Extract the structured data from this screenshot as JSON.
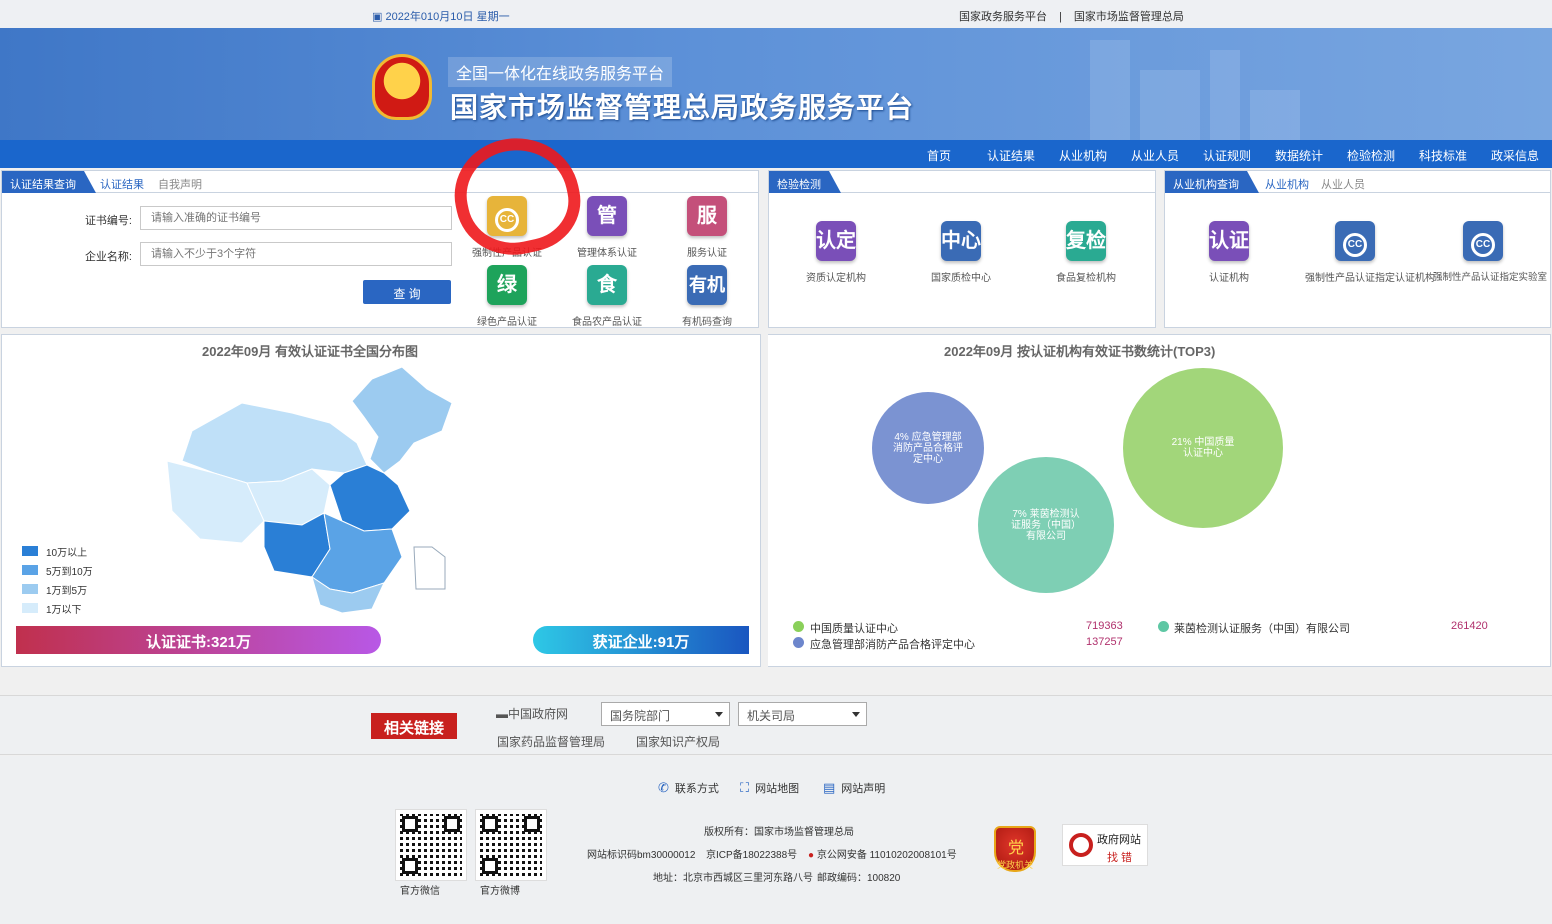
{
  "topbar": {
    "date": "2022年010月10日 星期一",
    "link1": "国家政务服务平台",
    "separator": "|",
    "link2": "国家市场监督管理总局"
  },
  "banner": {
    "subtitle": "全国一体化在线政务服务平台",
    "title": "国家市场监督管理总局政务服务平台"
  },
  "nav": [
    "首页",
    "认证结果",
    "从业机构",
    "从业人员",
    "认证规则",
    "数据统计",
    "检验检测",
    "科技标准",
    "政采信息"
  ],
  "query_panel": {
    "tab_main": "认证结果查询",
    "tab1": "认证结果",
    "tab2": "自我声明",
    "cert_label": "证书编号:",
    "cert_placeholder": "请输入准确的证书编号",
    "company_label": "企业名称:",
    "company_placeholder": "请输入不少于3个字符",
    "query_button": "查 询",
    "tiles": [
      {
        "icon": "ⓒⓒ",
        "label": "强制性产品认证",
        "color": "#e7b43a"
      },
      {
        "icon": "管",
        "label": "管理体系认证",
        "color": "#7a4fb8"
      },
      {
        "icon": "服",
        "label": "服务认证",
        "color": "#c4507a"
      },
      {
        "icon": "绿",
        "label": "绿色产品认证",
        "color": "#1ea35b"
      },
      {
        "icon": "食",
        "label": "食品农产品认证",
        "color": "#2aaa92"
      },
      {
        "icon": "有机",
        "label": "有机码查询",
        "color": "#3a6bb5"
      }
    ]
  },
  "inspection_panel": {
    "tab_main": "检验检测",
    "tiles": [
      {
        "icon": "认定",
        "label": "资质认定机构",
        "color": "#7a4fb8"
      },
      {
        "icon": "中心",
        "label": "国家质检中心",
        "color": "#3a6bb5"
      },
      {
        "icon": "复检",
        "label": "食品复检机构",
        "color": "#2aaa92"
      }
    ]
  },
  "org_panel": {
    "tab_main": "从业机构查询",
    "tab1": "从业机构",
    "tab2": "从业人员",
    "tiles": [
      {
        "icon": "认证",
        "label": "认证机构",
        "color": "#7a4fb8"
      },
      {
        "icon": "ⓒⓒ",
        "label": "强制性产品认证指定认证机构",
        "color": "#3a6bb5"
      },
      {
        "icon": "ⓒⓒ",
        "label": "强制性产品认证指定实验室",
        "color": "#3a6bb5"
      }
    ]
  },
  "map_panel": {
    "title": "2022年09月 有效认证证书全国分布图",
    "legend": [
      {
        "label": "10万以上",
        "color": "#2a7fd6"
      },
      {
        "label": "5万到10万",
        "color": "#5aa3e6"
      },
      {
        "label": "1万到5万",
        "color": "#9ccbf0"
      },
      {
        "label": "1万以下",
        "color": "#d6ecfb"
      }
    ],
    "cert_total": "认证证书:321万",
    "company_total": "获证企业:91万"
  },
  "bubble_panel": {
    "title": "2022年09月 按认证机构有效证书数统计(TOP3)",
    "bubbles": [
      {
        "text": "4% 应急管理部消防产品合格评定中心",
        "color": "#7b93d2"
      },
      {
        "text": "7% 莱茵检测认证服务（中国）有限公司",
        "color": "#7ecfb4"
      },
      {
        "text": "21% 中国质量认证中心",
        "color": "#a2d67a"
      }
    ],
    "legend": [
      {
        "name": "中国质量认证中心",
        "value": "719363",
        "color": "#8ad05a"
      },
      {
        "name": "莱茵检测认证服务（中国）有限公司",
        "value": "261420",
        "color": "#5ec7a4"
      },
      {
        "name": "应急管理部消防产品合格评定中心",
        "value": "137257",
        "color": "#6d86cc"
      }
    ]
  },
  "related": {
    "tag": "相关链接",
    "gov_link": "中国政府网",
    "select1": "国务院部门",
    "select2": "机关司局",
    "link_a": "国家药品监督管理局",
    "link_b": "国家知识产权局"
  },
  "footer": {
    "contact": "联系方式",
    "sitemap": "网站地图",
    "statement": "网站声明",
    "qr1_label": "官方微信",
    "qr2_label": "官方微博",
    "copyright": "版权所有：国家市场监督管理总局",
    "site_id": "网站标识码bm30000012",
    "icp": "京ICP备18022388号",
    "police": "京公网安备 11010202008101号",
    "address": "地址：北京市西城区三里河东路八号",
    "postcode": "邮政编码：100820",
    "badge_text": "党政机关",
    "gov_err_1": "政府网站",
    "gov_err_2": "找 错"
  }
}
